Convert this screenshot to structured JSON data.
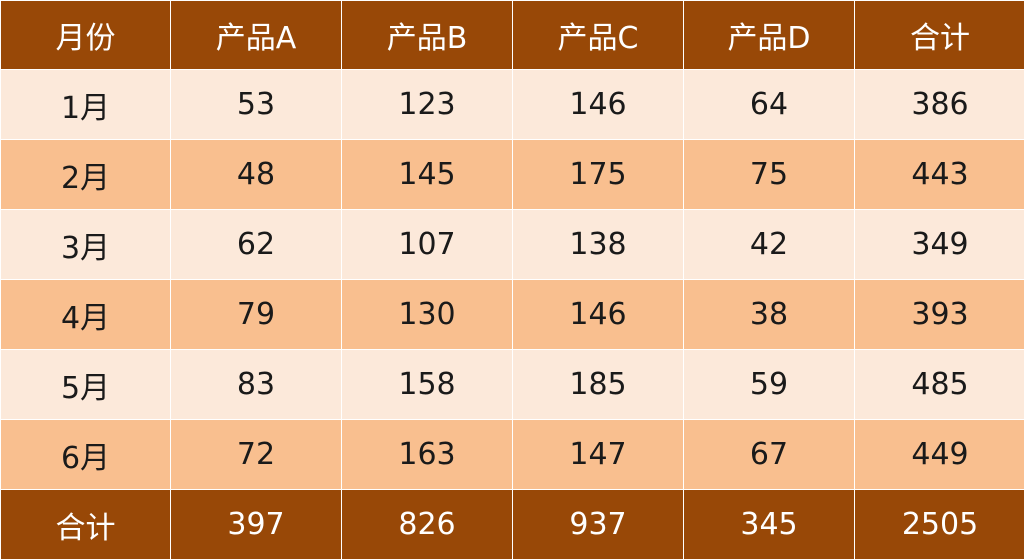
{
  "chart_data": {
    "type": "table",
    "columns": [
      "月份",
      "产品A",
      "产品B",
      "产品C",
      "产品D",
      "合计"
    ],
    "rows": [
      [
        "1月",
        "53",
        "123",
        "146",
        "64",
        "386"
      ],
      [
        "2月",
        "48",
        "145",
        "175",
        "75",
        "443"
      ],
      [
        "3月",
        "62",
        "107",
        "138",
        "42",
        "349"
      ],
      [
        "4月",
        "79",
        "130",
        "146",
        "38",
        "393"
      ],
      [
        "5月",
        "83",
        "158",
        "185",
        "59",
        "485"
      ],
      [
        "6月",
        "72",
        "163",
        "147",
        "67",
        "449"
      ]
    ],
    "footer": [
      "合计",
      "397",
      "826",
      "937",
      "345",
      "2505"
    ]
  },
  "colors": {
    "header_bg": "#984807",
    "row_light": "#fce9da",
    "row_dark": "#f9bf8f",
    "header_text": "#ffffff"
  }
}
